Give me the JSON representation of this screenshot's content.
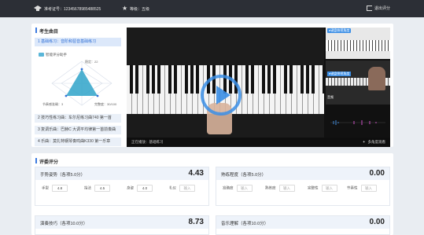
{
  "topbar": {
    "exam_label": "准考证号：",
    "exam_number": "12345678985488525",
    "grade_label": "等级：",
    "grade_value": "五级",
    "exit_label": "退出评分"
  },
  "tasks": {
    "section_title": "考生曲目",
    "items": [
      {
        "label": "1 基础练习：音阶和琶音基础练习"
      },
      {
        "label": "2 技巧性练习曲：车尔尼练习曲740 第一首"
      },
      {
        "label": "3 复调乐曲：巴赫C 大调平均律第一首前奏曲"
      },
      {
        "label": "4 乐曲：莫扎特钢琴奏鸣曲K330 第一乐章"
      }
    ]
  },
  "assistant": {
    "label": "智能评分助手",
    "dims": [
      {
        "name": "稳定",
        "value": "22"
      },
      {
        "name": "节奏感准确",
        "value": "3"
      },
      {
        "name": "完整度",
        "value": "30/100"
      }
    ]
  },
  "video": {
    "now_playing": "正在播放：基础练习",
    "multi_angle": "多角度观看",
    "side_tag_1": "●键盘俯视角度",
    "side_tag_2": "●键盘侧视角度",
    "side_label": "音频"
  },
  "scoring": {
    "section_title": "评委评分",
    "cards": [
      {
        "title": "手势姿势（各项5.0分）",
        "score": "4.43",
        "fields": [
          {
            "label": "手型",
            "value": "4.8"
          },
          {
            "label": "指法",
            "value": "4.5"
          },
          {
            "label": "身姿",
            "value": "4.0"
          },
          {
            "label": "礼仪",
            "value": "输入"
          }
        ]
      },
      {
        "title": "熟练程度（各项5.0分）",
        "score": "0.00",
        "fields": [
          {
            "label": "准确度",
            "value": "输入"
          },
          {
            "label": "熟练度",
            "value": "输入"
          },
          {
            "label": "完整性",
            "value": "输入"
          },
          {
            "label": "节奏性",
            "value": "输入"
          }
        ]
      },
      {
        "title": "演奏技巧（各项10.0分）",
        "score": "8.73"
      },
      {
        "title": "音乐理解（各项10.0分）",
        "score": "0.00"
      }
    ]
  },
  "colors": {
    "accent": "#3d7be0",
    "topbar": "#2c2f36",
    "radar_fill": "#2fa3c9"
  }
}
